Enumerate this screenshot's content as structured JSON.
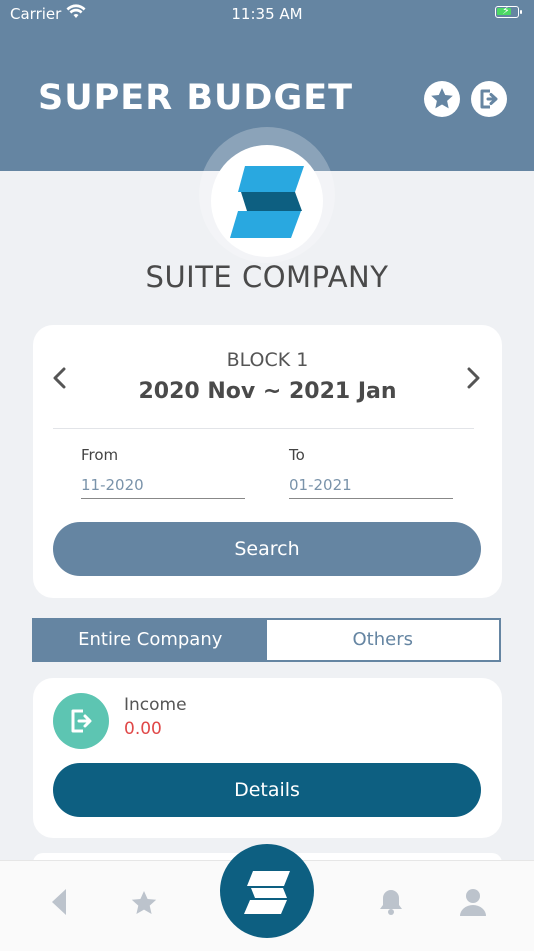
{
  "status_bar": {
    "carrier": "Carrier",
    "time": "11:35 AM"
  },
  "header": {
    "title": "SUPER BUDGET",
    "favorite_icon": "star-icon",
    "logout_icon": "logout-icon"
  },
  "company": {
    "name": "SUITE COMPANY"
  },
  "period": {
    "block_label": "BLOCK 1",
    "range": "2020 Nov ~ 2021 Jan",
    "from_label": "From",
    "from_value": "11-2020",
    "to_label": "To",
    "to_value": "01-2021",
    "search_label": "Search"
  },
  "segments": {
    "entire": "Entire Company",
    "others": "Others",
    "selected": "Entire Company"
  },
  "income": {
    "label": "Income",
    "value": "0.00",
    "details_label": "Details"
  },
  "colors": {
    "primary": "#6585a2",
    "dark": "#0d5f81",
    "income_icon": "#5dc5b2",
    "negative": "#e04848",
    "logo_light": "#29a8e0",
    "logo_dark": "#0d5f81"
  },
  "tabbar": {
    "icons": [
      "back-icon",
      "star-icon",
      "app-logo-icon",
      "bell-icon",
      "user-icon"
    ]
  }
}
